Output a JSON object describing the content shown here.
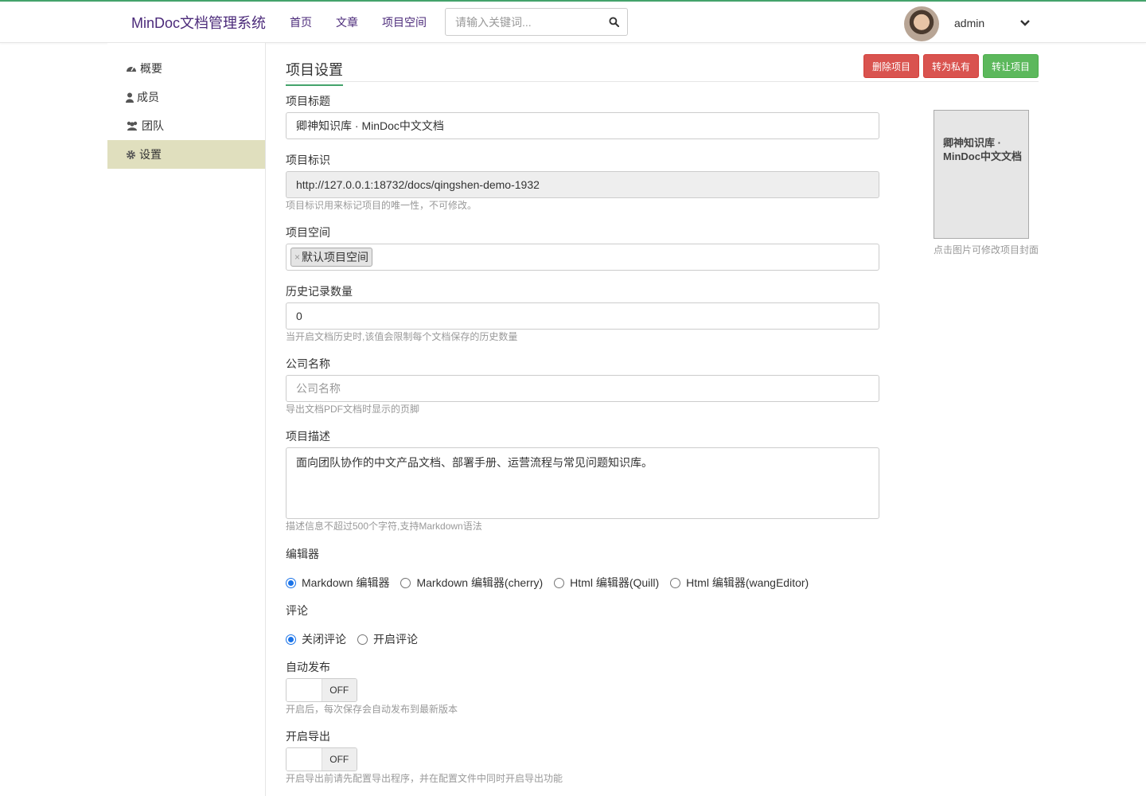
{
  "header": {
    "brand": "MinDoc文档管理系统",
    "nav": [
      "首页",
      "文章",
      "项目空间"
    ],
    "search_placeholder": "请输入关键词...",
    "username": "admin"
  },
  "sidebar": {
    "items": [
      {
        "label": "概要",
        "icon": "dashboard-icon",
        "active": false
      },
      {
        "label": "成员",
        "icon": "user-icon",
        "active": false
      },
      {
        "label": "团队",
        "icon": "users-icon",
        "active": false
      },
      {
        "label": "设置",
        "icon": "gear-icon",
        "active": true
      }
    ]
  },
  "page": {
    "title": "项目设置",
    "actions": {
      "delete": "删除项目",
      "private": "转为私有",
      "transfer": "转让项目"
    }
  },
  "form": {
    "title_label": "项目标题",
    "title_value": "卿神知识库 · MinDoc中文文档",
    "identify_label": "项目标识",
    "identify_value": "http://127.0.0.1:18732/docs/qingshen-demo-1932",
    "identify_help": "项目标识用来标记项目的唯一性，不可修改。",
    "space_label": "项目空间",
    "space_tag": "默认项目空间",
    "history_label": "历史记录数量",
    "history_value": "0",
    "history_help": "当开启文档历史时,该值会限制每个文档保存的历史数量",
    "company_label": "公司名称",
    "company_placeholder": "公司名称",
    "company_help": "导出文档PDF文档时显示的页脚",
    "desc_label": "项目描述",
    "desc_value": "面向团队协作的中文产品文档、部署手册、运营流程与常见问题知识库。",
    "desc_help": "描述信息不超过500个字符,支持Markdown语法",
    "editor_label": "编辑器",
    "editor_options": [
      "Markdown 编辑器",
      "Markdown 编辑器(cherry)",
      "Html 编辑器(Quill)",
      "Html 编辑器(wangEditor)"
    ],
    "editor_selected": 0,
    "comment_label": "评论",
    "comment_options": [
      "关闭评论",
      "开启评论"
    ],
    "comment_selected": 0,
    "autopublish_label": "自动发布",
    "autopublish_state": "OFF",
    "autopublish_help": "开启后，每次保存会自动发布到最新版本",
    "export_label": "开启导出",
    "export_state": "OFF",
    "export_help": "开启导出前请先配置导出程序，并在配置文件中同时开启导出功能"
  },
  "cover": {
    "text": "卿神知识库 · MinDoc中文文档",
    "help": "点击图片可修改项目封面"
  },
  "colors": {
    "accent": "#44a36b",
    "brand": "#4b2a7a",
    "danger": "#d9534f",
    "success": "#5cb85c",
    "sidebar_active": "#e0dfbe"
  }
}
